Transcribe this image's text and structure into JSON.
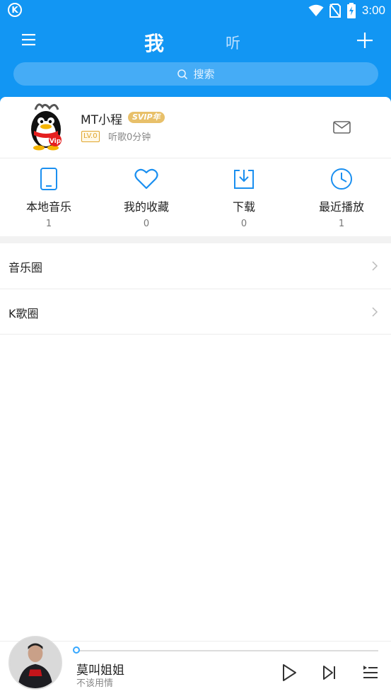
{
  "status_bar": {
    "time": "3:00",
    "app_icon_letter": "K"
  },
  "nav": {
    "tab_me": "我",
    "tab_listen": "听"
  },
  "search": {
    "placeholder": "搜索"
  },
  "user": {
    "name": "MT小程",
    "svip_badge": "SVIP年",
    "level": "LV.0",
    "listen_time": "听歌0分钟"
  },
  "quick_actions": [
    {
      "label": "本地音乐",
      "count": "1",
      "icon": "phone-icon"
    },
    {
      "label": "我的收藏",
      "count": "0",
      "icon": "heart-icon"
    },
    {
      "label": "下载",
      "count": "0",
      "icon": "download-icon"
    },
    {
      "label": "最近播放",
      "count": "1",
      "icon": "clock-icon"
    }
  ],
  "menu_rows": [
    {
      "label": "音乐圈"
    },
    {
      "label": "K歌圈"
    }
  ],
  "player": {
    "song": "莫叫姐姐",
    "artist": "不该用情",
    "progress": 0.0
  },
  "colors": {
    "brand": "#1296f3",
    "accent": "#35a7ff",
    "vip_gold": "#e8c06a"
  }
}
